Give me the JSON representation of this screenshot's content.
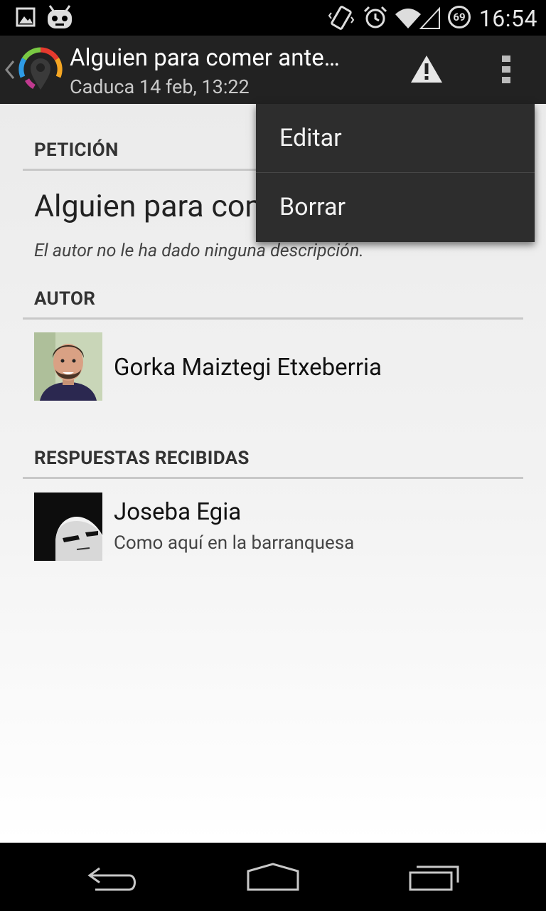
{
  "status_bar": {
    "time": "16:54",
    "battery": "69",
    "icons": [
      "image-notification-icon",
      "cyanogen-mascot-icon",
      "vibrate-icon",
      "alarm-icon",
      "wifi-icon",
      "signal-icon",
      "battery-icon"
    ]
  },
  "action_bar": {
    "title": "Alguien para comer ante…",
    "subtitle": "Caduca 14 feb, 13:22",
    "icons": [
      "back-chevron-icon",
      "app-logo-icon",
      "warning-icon",
      "overflow-menu-icon"
    ]
  },
  "overflow_menu": {
    "items": [
      {
        "label": "Editar"
      },
      {
        "label": "Borrar"
      }
    ]
  },
  "request": {
    "section_label": "PETICIÓN",
    "title": "Alguien para comer ante",
    "description": "El autor no le ha dado ninguna descripción."
  },
  "author": {
    "section_label": "AUTOR",
    "name": "Gorka Maiztegi Etxeberria"
  },
  "responses": {
    "section_label": "RESPUESTAS RECIBIDAS",
    "items": [
      {
        "name": "Joseba Egia",
        "message": "Como aquí en la barranquesa"
      }
    ]
  },
  "nav_bar": {
    "icons": [
      "back-icon",
      "home-icon",
      "recent-apps-icon"
    ]
  },
  "colors": {
    "action_bar_bg": "#222222",
    "menu_bg": "#2d2d2d",
    "warning_icon": "#e6e6e6"
  }
}
